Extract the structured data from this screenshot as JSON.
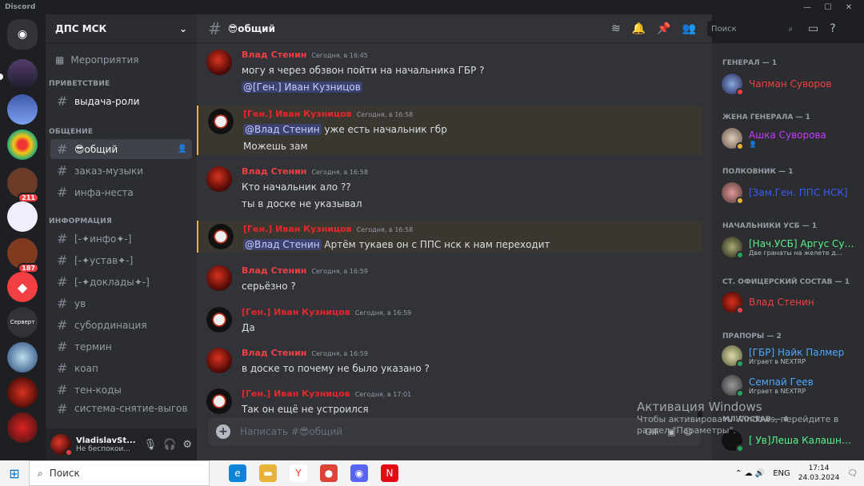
{
  "app": {
    "title": "Discord"
  },
  "guild": {
    "name": "ДПС МСК",
    "events_label": "Мероприятия"
  },
  "server_badges": {
    "b1": "211",
    "b2": "187",
    "serwert": "Серверт"
  },
  "categories": [
    "ПРИВЕТСТВИЕ",
    "ОБЩЕНИЕ",
    "ИНФОРМАЦИЯ"
  ],
  "channels": {
    "welcome": [
      "выдача-роли"
    ],
    "talk": [
      "😎общий",
      "заказ-музыки",
      "инфа-неста"
    ],
    "info": [
      "[-✦инфо✦-]",
      "[-✦устав✦-]",
      "[-✦доклады✦-]",
      "ув",
      "субординация",
      "термин",
      "коап",
      "тен-коды",
      "система-снятие-выгов"
    ]
  },
  "user": {
    "name": "VladislavSt...",
    "status": "Не беспокои..."
  },
  "channel": {
    "title": "😎общий",
    "placeholder": "Написать #😎общий",
    "search_label": "Поиск"
  },
  "messages": [
    {
      "author": "Влад Стенин",
      "color": "#f23f43",
      "time": "Сегодня, в 16:45",
      "lines": [
        "могу я через обзвон пойти на начальника ГБР ?"
      ],
      "mention_line": "@[Ген.] Иван Кузницов",
      "mention_after": ""
    },
    {
      "author": "[Ген.] Иван Кузницов",
      "color": "#e8262b",
      "time": "Сегодня, в 16:58",
      "mention_line": "@Влад Стенин",
      "mention_after": " уже есть начальник гбр",
      "lines": [
        "Можешь зам"
      ]
    },
    {
      "author": "Влад Стенин",
      "color": "#f23f43",
      "time": "Сегодня, в 16:58",
      "lines": [
        "Кто начальник ало ??",
        "ты в доске не указывал"
      ]
    },
    {
      "author": "[Ген.] Иван Кузницов",
      "color": "#e8262b",
      "time": "Сегодня, в 16:58",
      "mention_line": "@Влад Стенин",
      "mention_after": " Артём тукаев он с ППС нск к нам переходит",
      "lines": []
    },
    {
      "author": "Влад Стенин",
      "color": "#f23f43",
      "time": "Сегодня, в 16:59",
      "lines": [
        "серьёзно ?"
      ]
    },
    {
      "author": "[Ген.] Иван Кузницов",
      "color": "#e8262b",
      "time": "Сегодня, в 16:59",
      "lines": [
        "Да"
      ]
    },
    {
      "author": "Влад Стенин",
      "color": "#f23f43",
      "time": "Сегодня, в 16:59",
      "lines": [
        "в доске то почему не было указано ?"
      ]
    },
    {
      "author": "[Ген.] Иван Кузницов",
      "color": "#e8262b",
      "time": "Сегодня, в 17:01",
      "lines": [
        "Так он ещё не устроился"
      ]
    }
  ],
  "members": {
    "roles": [
      "ГЕНЕРАЛ — 1",
      "ЖЕНА ГЕНЕРАЛА — 1",
      "ПОЛКОВНИК — 1",
      "НАЧАЛЬНИКИ УСБ — 1",
      "СТ. ОФИЦЕРСКИЙ СОСТАВ — 1",
      "ПРАПОРЫ — 2",
      "МЛ.СОСТАВ — 4"
    ],
    "list": [
      {
        "name": "Чапман Суворов",
        "color": "#f23f43",
        "sub": ""
      },
      {
        "name": "Ашка Суворова",
        "color": "#c73bff",
        "sub": "👤"
      },
      {
        "name": "[Зам.Ген. ППС НСК]",
        "color": "#3b5bff",
        "sub": ""
      },
      {
        "name": "[Нач.УСБ] Аргус Сув...",
        "color": "#57f287",
        "sub": "Две гранаты на желете д..."
      },
      {
        "name": "Влад Стенин",
        "color": "#f23f43",
        "sub": ""
      },
      {
        "name": "[ГБР] Найк Палмер",
        "color": "#4ea8ff",
        "sub": "Играет в NEXTRP"
      },
      {
        "name": "Семпай Геев",
        "color": "#4ea8ff",
        "sub": "Играет в NEXTRP"
      },
      {
        "name": "[ Ув]Леша Калашник...",
        "color": "#57f287",
        "sub": ""
      }
    ]
  },
  "watermark": {
    "title": "Активация Windows",
    "text": "Чтобы активировать Windows, перейдите в раздел \"Параметры\"."
  },
  "taskbar": {
    "search": "Поиск",
    "lang": "ENG",
    "time": "17:14",
    "date": "24.03.2024"
  }
}
